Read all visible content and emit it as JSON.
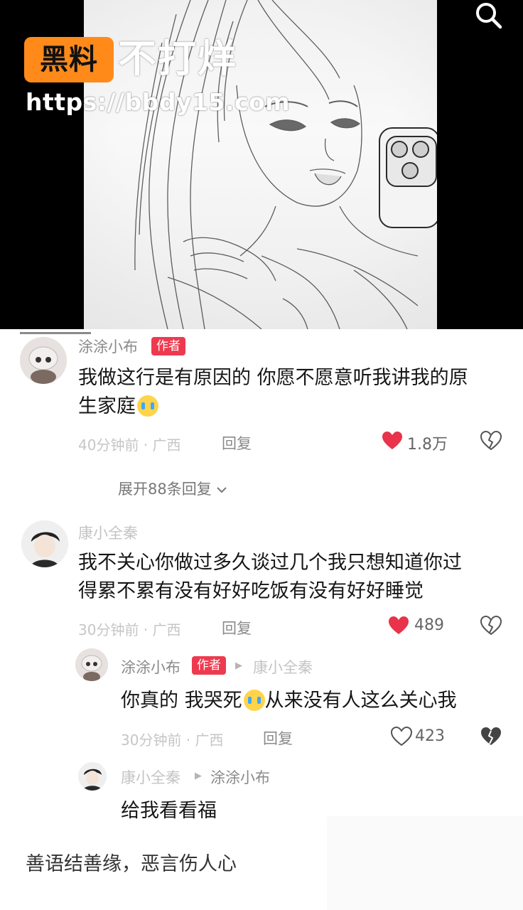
{
  "watermark": {
    "badge": "黑料",
    "text": "不打烊",
    "url": "https://bbdy15.com"
  },
  "comments": [
    {
      "author": "涂涂小布",
      "tag": "作者",
      "text_line1": "我做这行是有原因的 你愿不愿意听我讲我的原",
      "text_line2": "生家庭",
      "time": "40分钟前 · 广西",
      "reply_label": "回复",
      "likes": "1.8万",
      "liked": true,
      "expand_label": "展开88条回复"
    },
    {
      "author": "康小全秦",
      "text_line1": "我不关心你做过多久谈过几个我只想知道你过",
      "text_line2": "得累不累有没有好好吃饭有没有好好睡觉",
      "time": "30分钟前 · 广西",
      "reply_label": "回复",
      "likes": "489",
      "liked": true
    },
    {
      "author": "涂涂小布",
      "tag": "作者",
      "reply_to": "康小全秦",
      "text_before": "你真的 我哭死",
      "text_after": "从来没有人这么关心我",
      "time": "30分钟前 · 广西",
      "reply_label": "回复",
      "likes": "423",
      "liked": false
    },
    {
      "author": "康小全秦",
      "reply_to": "涂涂小布",
      "text": "给我看看福"
    }
  ],
  "footer_caption": "善语结善缘，恶言伤人心",
  "icons": [
    "search-icon",
    "heart-icon",
    "dislike-icon",
    "chevron-down-icon",
    "reply-arrow-icon",
    "crying-emoji-icon"
  ],
  "colors": {
    "author_tag": "#ee3a4f",
    "heart": "#e8334a",
    "watermark_badge": "#ff8a1a"
  }
}
